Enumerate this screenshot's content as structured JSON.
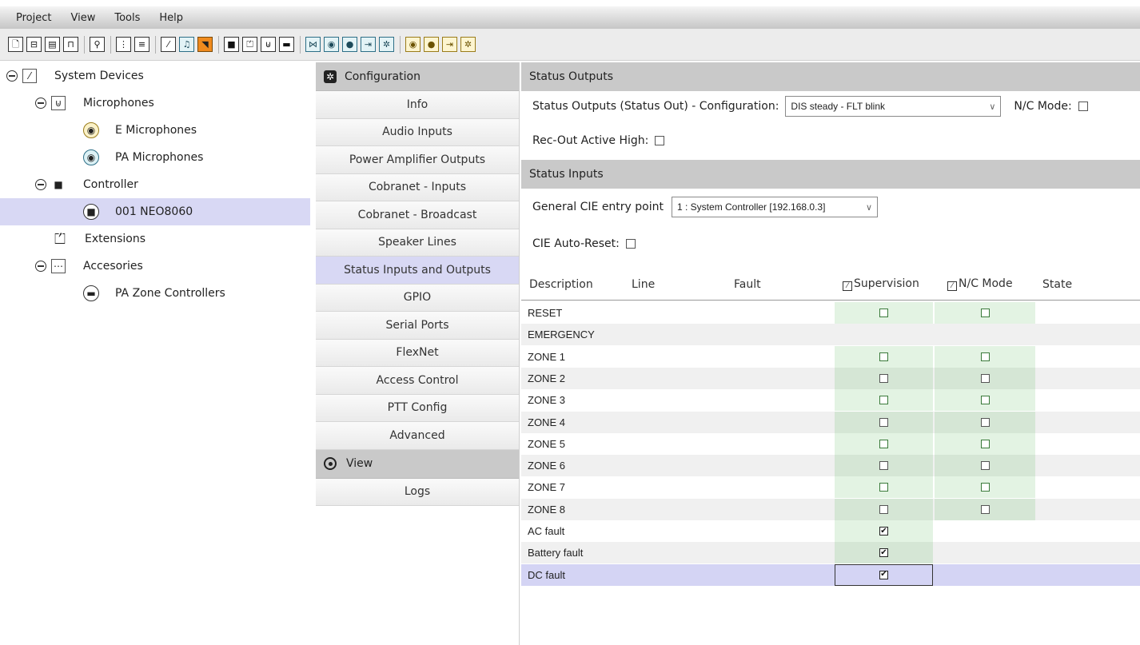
{
  "menu": [
    "Project",
    "View",
    "Tools",
    "Help"
  ],
  "toolbar": {
    "group1": [
      {
        "name": "new-file-icon",
        "glyph": "🗋"
      },
      {
        "name": "open-folder-icon",
        "glyph": "⊟"
      },
      {
        "name": "save-icon",
        "glyph": "▤"
      },
      {
        "name": "print-icon",
        "glyph": "⊓"
      }
    ],
    "group2": [
      {
        "name": "search-icon",
        "glyph": "⚲"
      }
    ],
    "group3": [
      {
        "name": "tree-view-icon",
        "glyph": "⋮"
      },
      {
        "name": "list-view-icon",
        "glyph": "≡"
      }
    ],
    "group4": [
      {
        "name": "pencil-icon",
        "glyph": "⁄"
      },
      {
        "name": "music-note-icon",
        "glyph": "♫"
      },
      {
        "name": "horn-icon",
        "glyph": "◥"
      }
    ],
    "group5": [
      {
        "name": "controller-icon",
        "glyph": "■"
      },
      {
        "name": "extension-icon",
        "glyph": "⏍"
      },
      {
        "name": "microphone-icon",
        "glyph": "⊍"
      },
      {
        "name": "zone-controller-icon",
        "glyph": "▬"
      }
    ],
    "group6": [
      {
        "name": "switch-icon",
        "glyph": "⋈"
      },
      {
        "name": "pa-microphone-icon",
        "glyph": "◉"
      },
      {
        "name": "speaker-icon",
        "glyph": "●"
      },
      {
        "name": "export-icon",
        "glyph": "⇥"
      },
      {
        "name": "settings-icon",
        "glyph": "✲"
      }
    ],
    "group7": [
      {
        "name": "e-microphone-icon",
        "glyph": "◉"
      },
      {
        "name": "speaker-gold-icon",
        "glyph": "●"
      },
      {
        "name": "export-gold-icon",
        "glyph": "⇥"
      },
      {
        "name": "settings-gold-icon",
        "glyph": "✲"
      }
    ]
  },
  "tree": {
    "system_devices": "System Devices",
    "microphones": "Microphones",
    "e_microphones": "E Microphones",
    "pa_microphones": "PA Microphones",
    "controller": "Controller",
    "neo": "001 NEO8060",
    "extensions": "Extensions",
    "accesories": "Accesories",
    "pa_zone_controllers": "PA Zone Controllers"
  },
  "nav": {
    "configuration": "Configuration",
    "items": [
      "Info",
      "Audio Inputs",
      "Power Amplifier Outputs",
      "Cobranet - Inputs",
      "Cobranet - Broadcast",
      "Speaker Lines",
      "Status Inputs and Outputs",
      "GPIO",
      "Serial Ports",
      "FlexNet",
      "Access Control",
      "PTT Config",
      "Advanced"
    ],
    "view": "View",
    "logs": "Logs"
  },
  "status_outputs": {
    "header": "Status Outputs",
    "config_label": "Status Outputs (Status Out) - Configuration:",
    "config_value": "DIS steady - FLT blink",
    "nc_mode_label": "N/C Mode:",
    "rec_out_label": "Rec-Out Active High:"
  },
  "status_inputs": {
    "header": "Status Inputs",
    "cie_label": "General CIE entry point",
    "cie_value": "1 : System Controller [192.168.0.3]",
    "cie_reset_label": "CIE Auto-Reset:"
  },
  "grid": {
    "headers": {
      "description": "Description",
      "line": "Line",
      "fault": "Fault",
      "supervision": "Supervision",
      "nc_mode": "N/C Mode",
      "state": "State"
    },
    "rows": [
      {
        "desc": "RESET",
        "supervision": false,
        "nc": false
      },
      {
        "desc": "EMERGENCY"
      },
      {
        "desc": "ZONE 1",
        "supervision": false,
        "nc": false
      },
      {
        "desc": "ZONE 2",
        "supervision": false,
        "nc": false
      },
      {
        "desc": "ZONE 3",
        "supervision": false,
        "nc": false
      },
      {
        "desc": "ZONE 4",
        "supervision": false,
        "nc": false
      },
      {
        "desc": "ZONE 5",
        "supervision": false,
        "nc": false
      },
      {
        "desc": "ZONE 6",
        "supervision": false,
        "nc": false
      },
      {
        "desc": "ZONE 7",
        "supervision": false,
        "nc": false
      },
      {
        "desc": "ZONE 8",
        "supervision": false,
        "nc": false
      },
      {
        "desc": "AC fault",
        "supervision": true
      },
      {
        "desc": "Battery fault",
        "supervision": true
      },
      {
        "desc": "DC fault",
        "supervision": true
      }
    ]
  }
}
